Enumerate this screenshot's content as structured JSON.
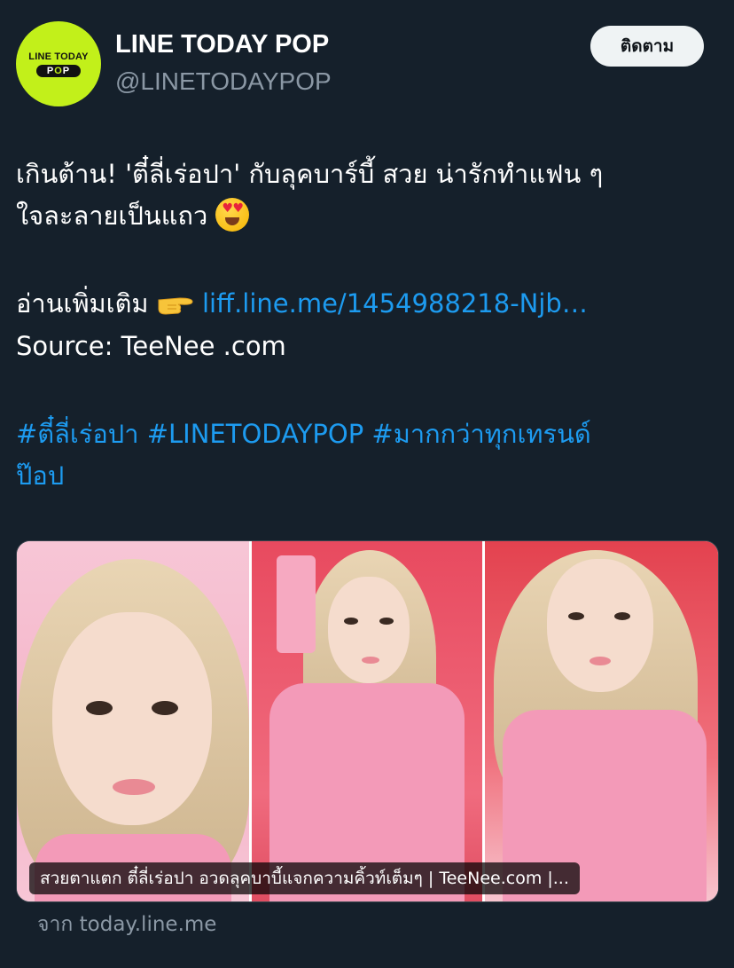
{
  "account": {
    "logo_line1": "LINE TODAY",
    "logo_line2_prefix": "P",
    "logo_line2_o": "O",
    "logo_line2_suffix": "P",
    "name": "LINE TODAY POP",
    "handle": "@LINETODAYPOP",
    "follow_label": "ติดตาม"
  },
  "tweet": {
    "line1": "เกินต้าน! 'ตี๋ลี่เร่อปา' กับลุคบาร์บี้ สวย น่ารักทำแฟน ๆ",
    "line2": "ใจละลายเป็นแถว",
    "line2_emoji": "smiling-face-with-heart-eyes",
    "read_more": "อ่านเพิ่มเติม",
    "read_more_emoji": "backhand-index-pointing-right",
    "link": "liff.line.me/1454988218-Njb…",
    "source": "Source: TeeNee .com",
    "hashtags_line1": "#ตี๋ลี่เร่อปา #LINETODAYPOP #มากกว่าทุกเทรนด์",
    "hashtags_line2": "ป๊อป"
  },
  "card": {
    "caption": "สวยตาแตก ตี๋ลี่เร่อปา อวดลุคบาบี้แจกความคิ้วท์เต็มๆ | TeeNee.com |...",
    "source": "จาก today.line.me"
  },
  "colors": {
    "background": "#15202b",
    "link": "#1d9bf0",
    "secondary_text": "#8b98a5",
    "logo_green": "#c2f01a"
  }
}
